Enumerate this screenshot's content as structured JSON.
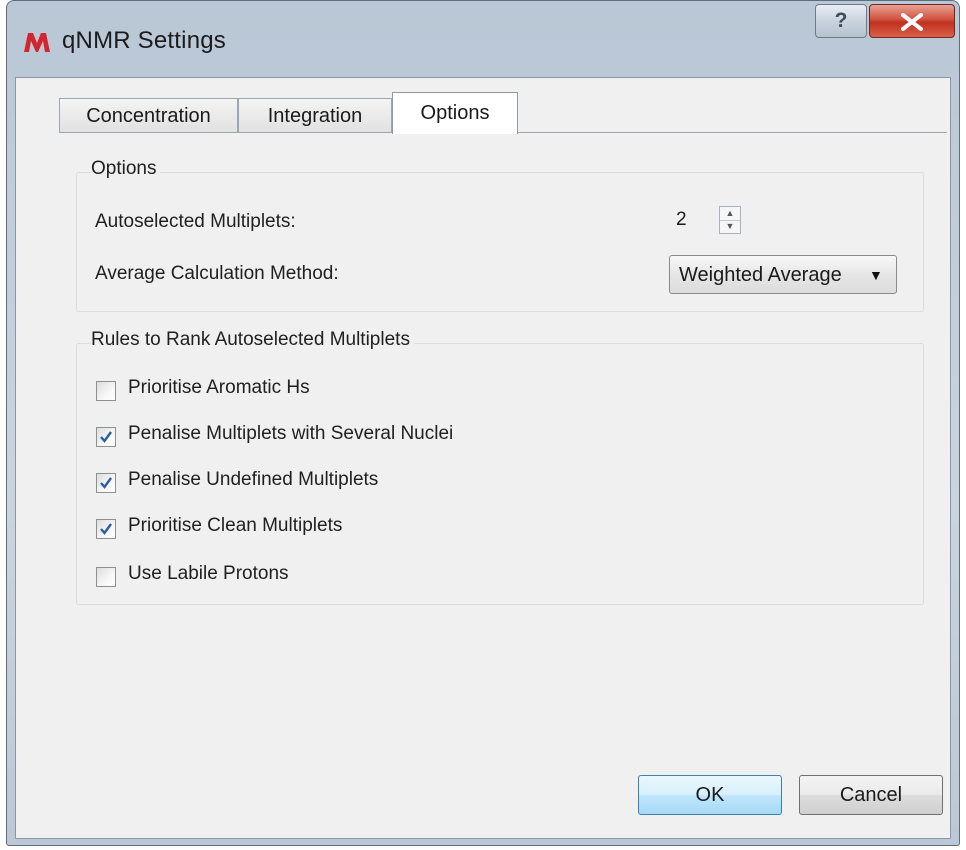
{
  "window": {
    "title": "qNMR Settings",
    "help_glyph": "?",
    "accent": "#c0321e"
  },
  "tabs": [
    {
      "label": "Concentration",
      "active": false
    },
    {
      "label": "Integration",
      "active": false
    },
    {
      "label": "Options",
      "active": true
    }
  ],
  "options_group": {
    "title": "Options",
    "autoselected_label": "Autoselected Multiplets:",
    "autoselected_value": "2",
    "average_label": "Average Calculation Method:",
    "average_value": "Weighted Average"
  },
  "rules_group": {
    "title": "Rules to Rank Autoselected Multiplets",
    "items": [
      {
        "label": "Prioritise Aromatic Hs",
        "checked": false
      },
      {
        "label": "Penalise Multiplets with Several Nuclei",
        "checked": true
      },
      {
        "label": "Penalise Undefined Multiplets",
        "checked": true
      },
      {
        "label": "Prioritise Clean Multiplets",
        "checked": true
      },
      {
        "label": "Use Labile Protons",
        "checked": false
      }
    ]
  },
  "buttons": {
    "ok": "OK",
    "cancel": "Cancel"
  },
  "icons": {
    "app": "mestrenova-app-icon",
    "help": "help-icon",
    "close": "close-icon",
    "check": "check-icon",
    "dropdown": "chevron-down-icon",
    "spin": "spin-arrows-icon"
  }
}
